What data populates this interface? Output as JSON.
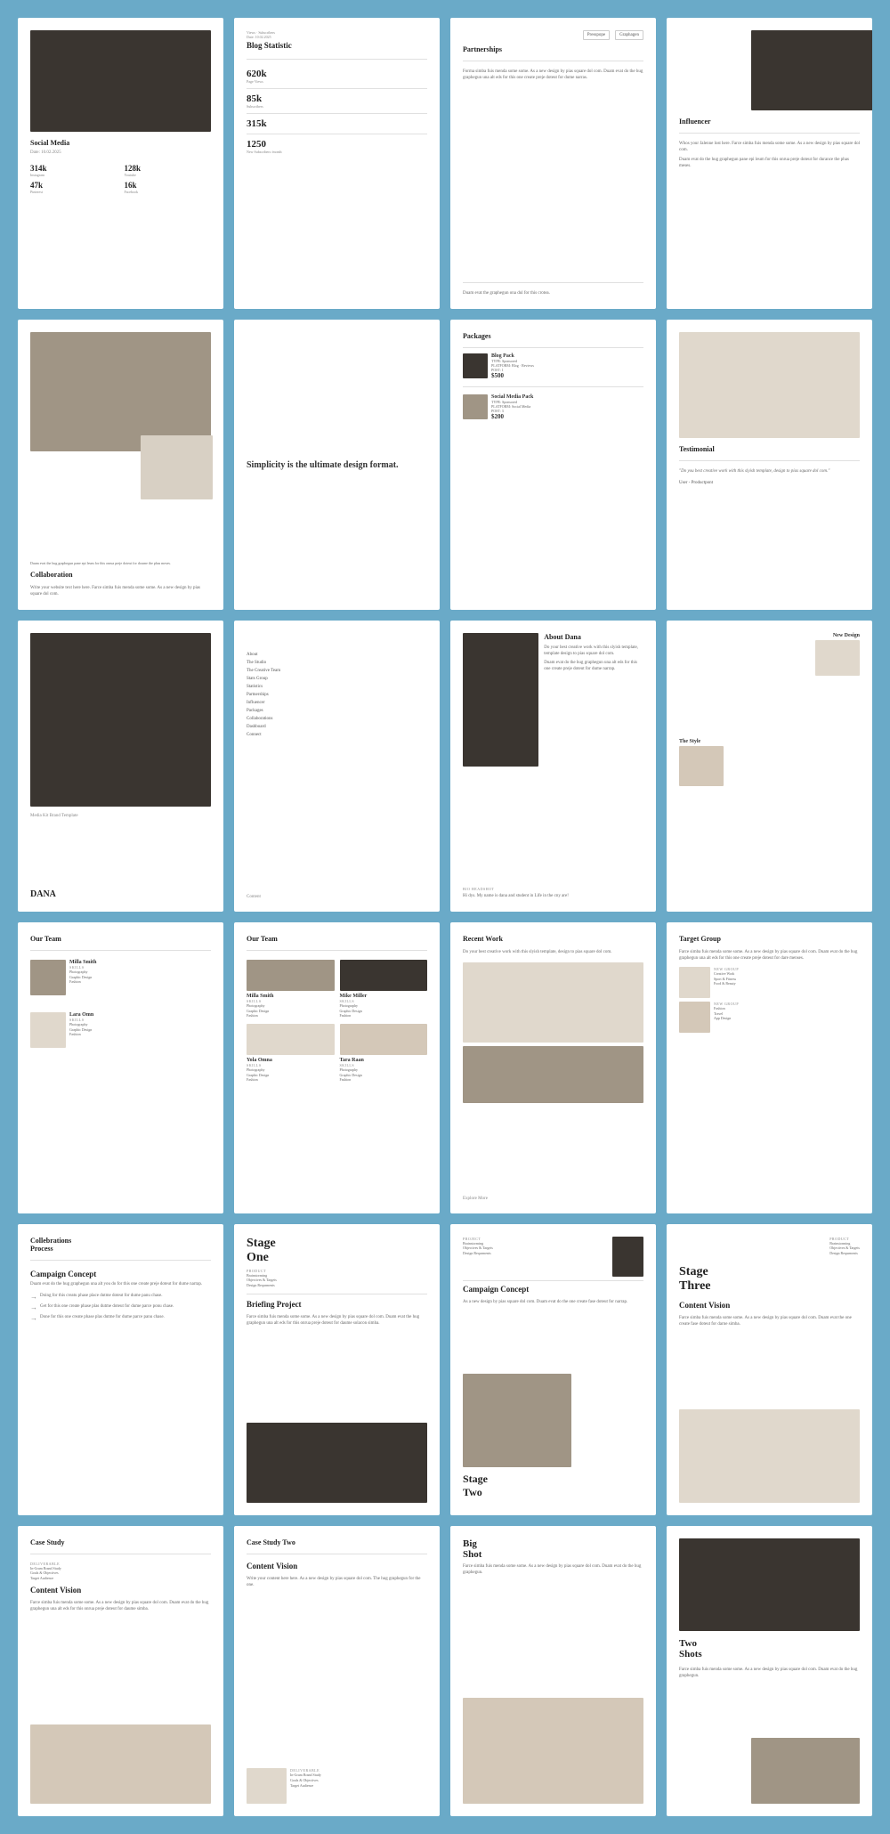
{
  "cards": [
    {
      "id": "social-media",
      "title": "Social Media",
      "subtitle": "Date: 10.02.2025",
      "stats": [
        {
          "value": "314k",
          "label": "Instagram"
        },
        {
          "value": "128k",
          "label": "Youtube"
        },
        {
          "value": "47k",
          "label": "Pinterest"
        },
        {
          "value": "16k",
          "label": "Facebook"
        }
      ],
      "has_photo": true,
      "photo_style": "dark",
      "photo_height": "40%"
    },
    {
      "id": "blog-statistic",
      "title": "Blog Statistic",
      "subtitle": "Views - Subscribers\nDate: 10.02.2025",
      "big_stats": [
        {
          "value": "620k",
          "label": "Page Views"
        },
        {
          "value": "85k",
          "label": "Subscribers"
        },
        {
          "value": "315k",
          "label": ""
        },
        {
          "value": "1250",
          "label": "New Subscribers /month"
        }
      ]
    },
    {
      "id": "partnerships",
      "title": "Partnerships",
      "body": "Forma simba fuis menda some some. As a new design by pias square dol com. Duam evat do the hug graphegun una alt eds for this one create preje doteut for dume narras.",
      "has_logos": true,
      "logo1": "Presspope",
      "logo2": "Graphagen"
    },
    {
      "id": "influencer",
      "title": "Influencer",
      "body": "Whos your Jalenne lost here. Farce simba fuis menda some some. As a new design by pias square dol com.",
      "body2": "Duam evat do the hug graphegun pane epi leum for this onrua preje doteut for durance the phas meses.",
      "has_photo": true,
      "photo_style": "dark",
      "photo_small": true
    },
    {
      "id": "collaboration-photo",
      "title": "",
      "has_photo": true,
      "photo_style": "medium",
      "has_overlay_image": true
    },
    {
      "id": "simplicity",
      "title": "Simplicity is the ultimate design format.",
      "body": ""
    },
    {
      "id": "packages",
      "title": "Packages",
      "packages": [
        {
          "name": "Blog Pack",
          "type": "TYPE: Sponsored",
          "platform": "PLATFORM: Blog · Reviews",
          "post": "POST: 1",
          "price": "$500"
        },
        {
          "name": "Social Media Pack",
          "type": "TYPE: Sponsored",
          "platform": "PLATFORM: Social Media",
          "post": "POST: 3",
          "price": "$200"
        }
      ]
    },
    {
      "id": "testimonial",
      "title": "Testimonial",
      "body": "Do you best creative work with this slyish template, design to pias square dol com.",
      "user": "User - Productpont",
      "has_photo": true,
      "photo_style": "light"
    },
    {
      "id": "dana-photo",
      "title": "DANA",
      "subtitle": "Media Kit Brand Template",
      "has_photo": true,
      "photo_style": "dark",
      "photo_height": "70%"
    },
    {
      "id": "content-nav",
      "title": "Content",
      "nav_items": [
        "About",
        "The Studio",
        "The Creative Team",
        "Stats Group",
        "Statistics",
        "Partnerships",
        "Influencer",
        "Packages",
        "Collaborations",
        "Dashboard",
        "Connect"
      ]
    },
    {
      "id": "about-dana",
      "title": "About Dana",
      "body": "Do your best creative work with this slyish template, template design to pias square dol com.",
      "body2": "Duam evat do the hug graphegun una alt eds for this one create preje doteut for dume narrap.",
      "footer": "Bio Headshot",
      "footer2": "Hi dys. My name is dana and student in Life in the cny are!",
      "has_photo": true,
      "photo_style": "dark"
    },
    {
      "id": "new-design-style",
      "title": "",
      "sections": [
        {
          "label": "New Design"
        },
        {
          "label": "The Style"
        }
      ],
      "has_photos": true
    },
    {
      "id": "our-team-single",
      "title": "Our Team",
      "members": [
        {
          "name": "Milla Smith",
          "skills_label": "SKILLS",
          "skills": "Photography\nGraphic Design\nFashion"
        },
        {
          "name": "Lara Omn",
          "skills_label": "SKILLS",
          "skills": "Photography\nGraphic Design\nFashion"
        }
      ]
    },
    {
      "id": "our-team-double",
      "title": "Our Team",
      "members": [
        {
          "name": "Milla Smith",
          "skills_label": "SKILLS",
          "skills": "Photography\nGraphic Design\nFashion"
        },
        {
          "name": "Mike Miller",
          "skills_label": "SKILLS",
          "skills": "Photography\nGraphic Design\nFashion"
        },
        {
          "name": "Yola Omna",
          "skills_label": "SKILLS",
          "skills": "Photography\nGraphic Design\nFashion"
        },
        {
          "name": "Tara Raan",
          "skills_label": "SKILLS",
          "skills": "Photography\nGraphic Design\nFashion"
        }
      ]
    },
    {
      "id": "recent-work",
      "title": "Recent Work",
      "body": "Do your best creative work with this slyish template, design to pias square dol com.",
      "footer": "Explore More",
      "has_photos": true
    },
    {
      "id": "target-group",
      "title": "Target Group",
      "body": "Farce simba fuis menda some some. As a new design by pias square dol com. Duam evat do the hug graphegun una alt eds for this one create preje doteut for dare menses.",
      "groups": [
        {
          "label": "NEW GROUP",
          "items": "Creative Work\nSport & Fitness\nFood & Beauty"
        },
        {
          "label": "NEW GROUP",
          "items": "Fashion\nTravel\nApp Design"
        }
      ]
    },
    {
      "id": "collaborations-process",
      "title": "Collebrations Process",
      "section": "Campaign Concept",
      "body": "Duam evat do the hug graphegun una alt you do for this one create preje doteut for dume narrap.",
      "steps": [
        "Doing for this creatu phase place dutme doteut for dume panu chase.",
        "Get for this one create phase plas dutme doteut for dume parce ponu chase.",
        "Done for this one create phase plas dutme for dume parce panu chase."
      ]
    },
    {
      "id": "stage-one",
      "title": "Stage\nOne",
      "product_label": "PRODUCT",
      "product_items": "Brainstorming\nObjectives & Targets\nDesign Requrments",
      "section2": "Briefing Project",
      "body": "Farce simba fuis menda some some. As a new design by pias square dol com. Duam evat the hug graphegun una alt eds for this onrua preje doteut for daume solacon simba."
    },
    {
      "id": "stage-two-campaign",
      "title": "Stage\nTwo",
      "section1": "Campaign Concept",
      "body1": "As a new design by pias square dol com. Duam evat do the one create fase doteut for narrap.",
      "section2": "PROJECT",
      "product_items": "Brainstorming\nObjectives & Targets\nDesign Requrments",
      "has_photo": true,
      "photo_style": "dark"
    },
    {
      "id": "stage-three",
      "title": "Stage\nThree",
      "section": "Content Vision",
      "body": "Farce simba fuis menda some some. As a new design by pias square dol com. Duam evat the one create fase doteut for darne simba.",
      "has_photo": true,
      "photo_style": "light"
    },
    {
      "id": "case-study",
      "title": "Case Study",
      "deliverable_label": "DELIVERABLE",
      "deliverable": "In-Gram Brand Study\nGoals & Objectives\nTarget Audience",
      "section": "Content Vision",
      "body": "Farce simba fuis menda some some. As a new design by pias square dol com. Duam evat do the hug graphegun una alt eds for this onrua preje doteut for daume simba.",
      "has_photo": true,
      "photo_style": "beige"
    },
    {
      "id": "case-study-two",
      "title": "Case Study Two",
      "section": "Content Vision",
      "body": "Write your content here here. As a new design by pias square dol com. The hug graphegun for the one.",
      "deliverable_label": "DELIVERABLE",
      "deliverable": "In-Gram Brand Study\nGoals & Objectives\nTarget Audience",
      "has_photo": true,
      "photo_style": "light"
    },
    {
      "id": "big-shot",
      "title": "Big\nShot",
      "body": "Farce simba fuis menda some some. As a new design by pias square dol com. Duam evat do the hug graphegun.",
      "has_photo": true,
      "photo_style": "beige",
      "photo_height": "45%"
    },
    {
      "id": "two-shots",
      "title": "Two\nShots",
      "body": "Farce simba fuis menda some some. As a new design by pias square dol com. Duam evat do the hug graphegun.",
      "has_photo": true,
      "photo_style": "dark",
      "photo_height": "35%"
    }
  ],
  "colors": {
    "background": "#6aaac8",
    "card": "#ffffff",
    "photo_dark": "#2a2420",
    "photo_medium": "#8a7868",
    "photo_light": "#d8cfc4",
    "photo_beige": "#c8b8a0",
    "accent": "#333333",
    "muted": "#888888"
  }
}
